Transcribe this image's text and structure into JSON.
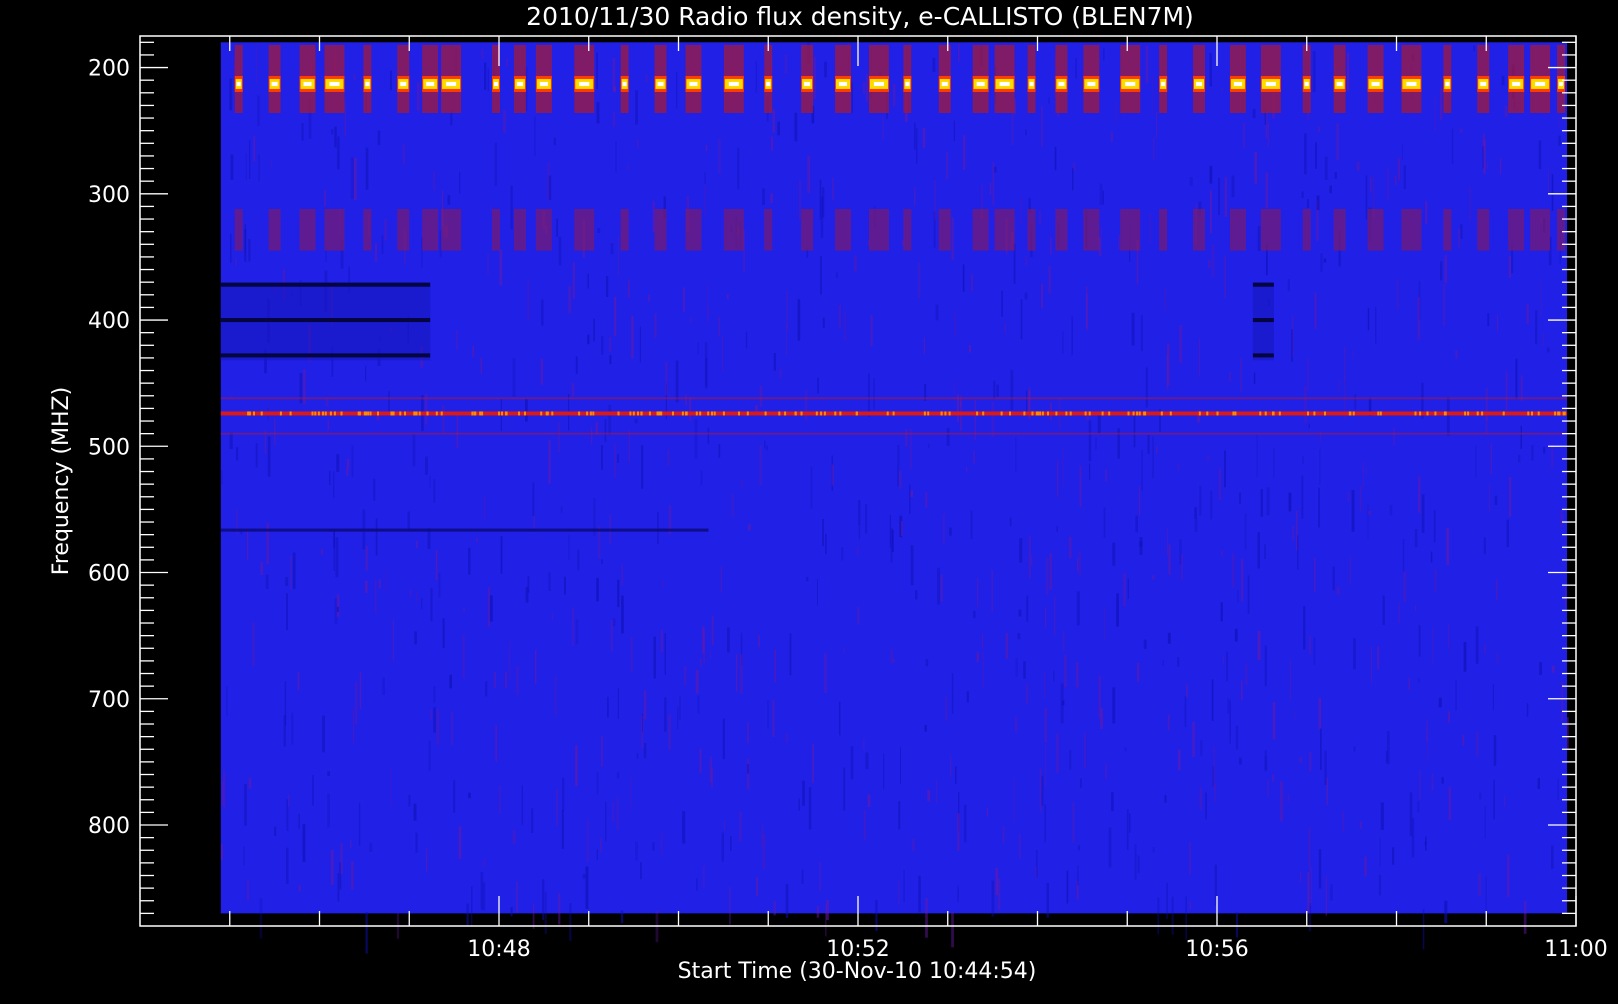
{
  "chart_data": {
    "type": "heatmap",
    "title": "2010/11/30  Radio flux density, e-CALLISTO (BLEN7M)",
    "xlabel": "Start Time (30-Nov-10 10:44:54)",
    "ylabel": "Frequency (MHZ)",
    "x_start": "10:44:54",
    "x_end": "10:59:54",
    "xlim": [
      "10:44:00",
      "11:00:00"
    ],
    "ylim": [
      175,
      880
    ],
    "y_reversed": true,
    "data_freq_range": [
      180,
      870
    ],
    "x_ticks": [
      "10:48",
      "10:52",
      "10:56",
      "11:00"
    ],
    "y_ticks": [
      200,
      300,
      400,
      500,
      600,
      700,
      800
    ],
    "colormap": [
      "#000000",
      "#0000c8",
      "#3a28ff",
      "#c81a1a",
      "#ff5000",
      "#ffdc00",
      "#ffffff"
    ],
    "background_color": "#2020e6",
    "features": {
      "burst_band_mhz": 213,
      "burst_times": [
        "10:45:06",
        "10:45:30",
        "10:45:52",
        "10:46:10",
        "10:46:32",
        "10:46:56",
        "10:47:14",
        "10:47:28",
        "10:47:58",
        "10:48:14",
        "10:48:30",
        "10:48:57",
        "10:49:24",
        "10:49:48",
        "10:50:10",
        "10:50:37",
        "10:51:00",
        "10:51:26",
        "10:51:50",
        "10:52:14",
        "10:52:33",
        "10:52:58",
        "10:53:22",
        "10:53:38",
        "10:53:56",
        "10:54:16",
        "10:54:36",
        "10:55:02",
        "10:55:24",
        "10:55:48",
        "10:56:14",
        "10:56:36",
        "10:57:00",
        "10:57:22",
        "10:57:46",
        "10:58:10",
        "10:58:34",
        "10:58:58",
        "10:59:20",
        "10:59:36",
        "10:59:50"
      ],
      "interference_line_mhz": 474,
      "interference_line_faint_mhz": [
        462,
        490
      ],
      "dark_bands_mhz": [
        372,
        400,
        428
      ],
      "dark_band_intervals": [
        [
          "10:44:54",
          "10:47:14"
        ],
        [
          "10:56:24",
          "10:56:38"
        ]
      ],
      "dark_line_mhz": 566
    }
  }
}
